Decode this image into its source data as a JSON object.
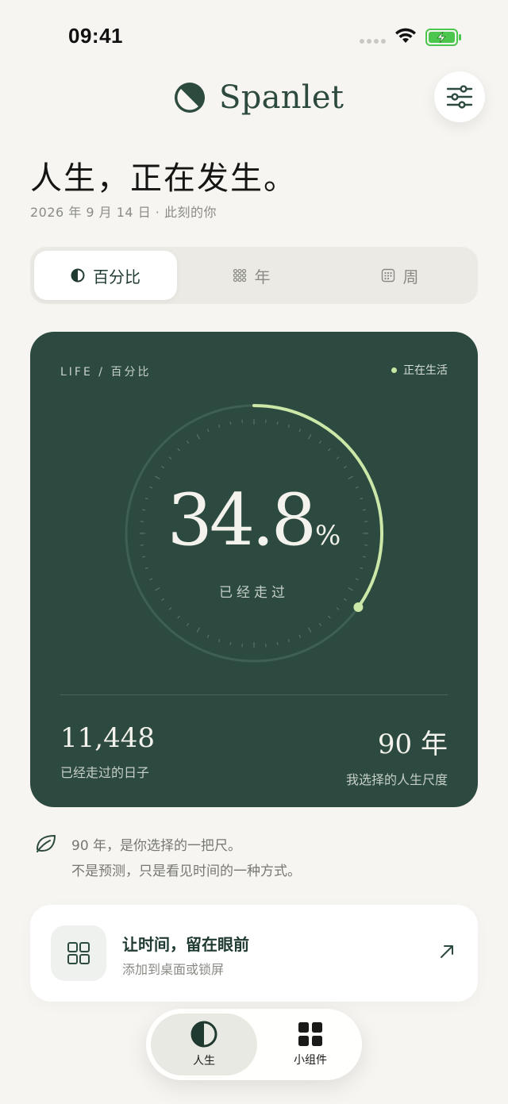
{
  "status_bar": {
    "time": "09:41"
  },
  "header": {
    "brand": "Spanlet"
  },
  "hero": {
    "title": "人生，正在发生。",
    "subtitle": "2026 年 9 月 14 日 · 此刻的你"
  },
  "segmented": [
    {
      "label": "百分比",
      "icon": "half-circle-icon",
      "active": true
    },
    {
      "label": "年",
      "icon": "dot-grid-icon",
      "active": false
    },
    {
      "label": "周",
      "icon": "calendar-grid-icon",
      "active": false
    }
  ],
  "card": {
    "eyebrow": "LIFE  /  百分比",
    "status": "正在生活",
    "percent_value": "34.8",
    "percent_unit": "%",
    "progress_fraction": 0.348,
    "caption": "已经走过",
    "days_value": "11,448",
    "days_label": "已经走过的日子",
    "span_value": "90 年",
    "span_label": "我选择的人生尺度"
  },
  "note": {
    "line1": "90 年，是你选择的一把尺。",
    "line2": "不是预测，只是看见时间的一种方式。",
    "icon": "leaf-icon"
  },
  "widget_promo": {
    "title": "让时间，留在眼前",
    "subtitle": "添加到桌面或锁屏",
    "icon": "grid-icon",
    "action_icon": "arrow-up-right-icon"
  },
  "tabbar": {
    "tabs": [
      {
        "label": "人生",
        "icon": "half-circle-icon",
        "active": true
      },
      {
        "label": "小组件",
        "icon": "grid-icon",
        "active": false
      }
    ]
  },
  "colors": {
    "background": "#f6f5f1",
    "brand_green": "#2c4a3f",
    "accent_lime": "#c8e6a3"
  }
}
